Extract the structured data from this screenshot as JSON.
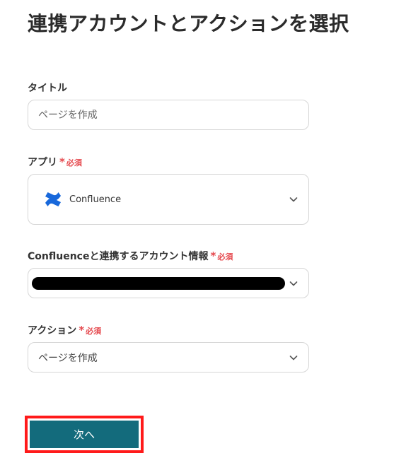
{
  "page_title": "連携アカウントとアクションを選択",
  "fields": {
    "title": {
      "label": "タイトル",
      "placeholder": "ページを作成"
    },
    "app": {
      "label": "アプリ",
      "required_mark": "*",
      "required_text": "必須",
      "value": "Confluence",
      "icon": "confluence-logo-icon"
    },
    "account": {
      "label": "Confluenceと連携するアカウント情報",
      "required_mark": "*",
      "required_text": "必須",
      "value_redacted": true
    },
    "action": {
      "label": "アクション",
      "required_mark": "*",
      "required_text": "必須",
      "value": "ページを作成"
    }
  },
  "next_button": {
    "label": "次へ"
  },
  "colors": {
    "required": "#e5484d",
    "button_bg": "#136b7c",
    "highlight_frame": "#ff1a1a",
    "confluence_blue": "#1868db"
  }
}
